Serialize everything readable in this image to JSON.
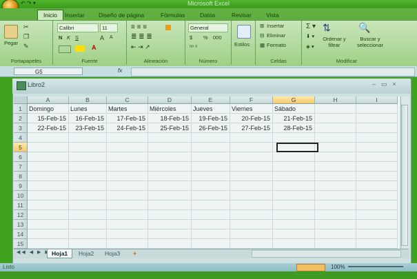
{
  "window": {
    "app_title": "Microsoft Excel",
    "qat": "↶ ↷ ▾"
  },
  "ribbon": {
    "tabs": [
      "Inicio",
      "Insertar",
      "Diseño de página",
      "Fórmulas",
      "Datos",
      "Revisar",
      "Vista"
    ],
    "active_tab": "Inicio",
    "clipboard": {
      "paste": "Pegar",
      "label": "Portapapeles"
    },
    "font": {
      "name": "Calibri",
      "size": "11",
      "label": "Fuente",
      "bold": "N",
      "italic": "K",
      "underline": "S",
      "grow": "A",
      "shrink": "A"
    },
    "alignment": {
      "label": "Alineación"
    },
    "number": {
      "format": "General",
      "currency": "$",
      "percent": "%",
      "thousands": "000",
      "label": "Número"
    },
    "styles": {
      "label": "Estilos"
    },
    "cells": {
      "insert": "Insertar",
      "delete": "Eliminar",
      "format": "Formato",
      "label": "Celdas"
    },
    "editing": {
      "sort": "Ordenar y filtrar",
      "find": "Buscar y seleccionar",
      "label": "Modificar"
    }
  },
  "formula_bar": {
    "name_box": "G5",
    "fx": "fx",
    "value": ""
  },
  "workbook": {
    "title": "Libro2"
  },
  "grid": {
    "columns": [
      "A",
      "B",
      "C",
      "D",
      "E",
      "F",
      "G",
      "H",
      "I"
    ],
    "selected_col": "G",
    "rows": [
      [
        "Domingo",
        "Lunes",
        "Martes",
        "Miércoles",
        "Jueves",
        "Viernes",
        "Sábado",
        "",
        ""
      ],
      [
        "15-Feb-15",
        "16-Feb-15",
        "17-Feb-15",
        "18-Feb-15",
        "19-Feb-15",
        "20-Feb-15",
        "21-Feb-15",
        "",
        ""
      ],
      [
        "22-Feb-15",
        "23-Feb-15",
        "24-Feb-15",
        "25-Feb-15",
        "26-Feb-15",
        "27-Feb-15",
        "28-Feb-15",
        "",
        ""
      ]
    ],
    "row_count": 15,
    "selected_row": 5
  },
  "sheets": {
    "tabs": [
      "Hoja1",
      "Hoja2",
      "Hoja3"
    ],
    "active": "Hoja1"
  },
  "status": {
    "text": "Listo",
    "zoom": "100%"
  }
}
